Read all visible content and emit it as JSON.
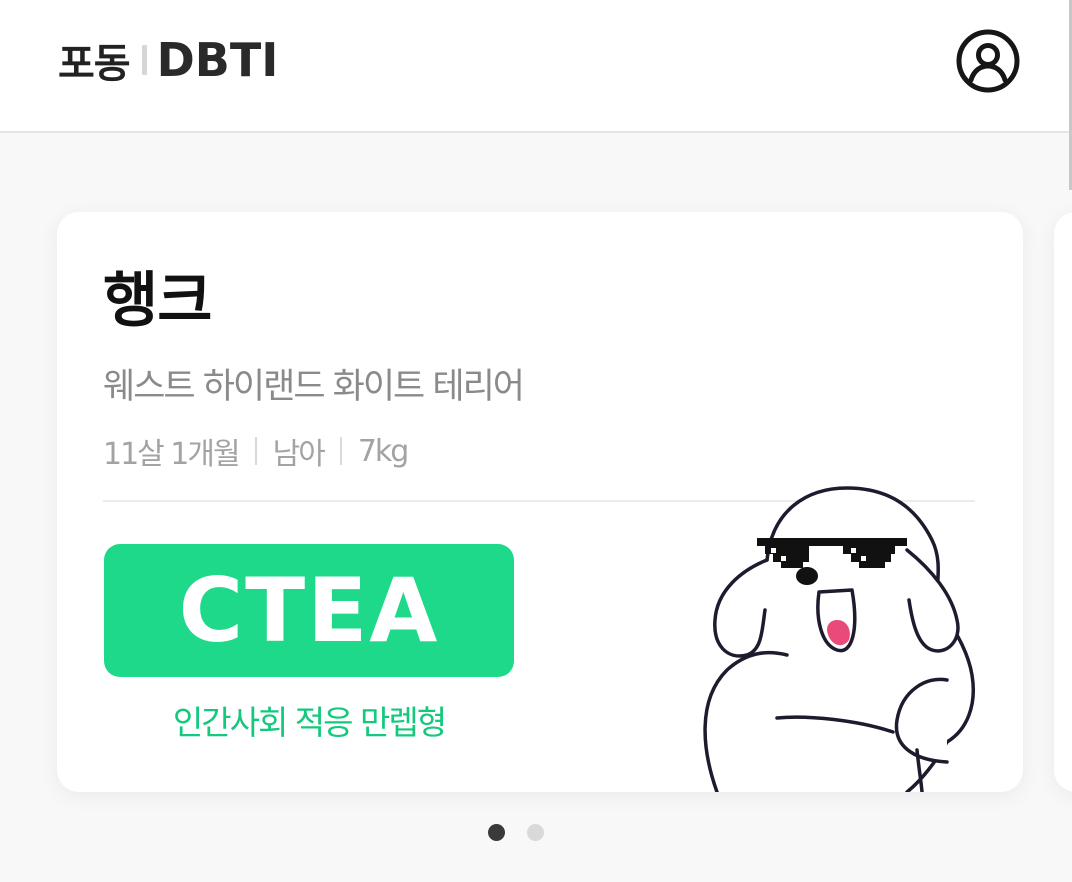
{
  "header": {
    "logo_ko": "포동",
    "logo_en": "DBTI",
    "profile_icon": "user-circle-icon"
  },
  "card": {
    "name": "행크",
    "breed": "웨스트 하이랜드 화이트 테리어",
    "meta": {
      "age": "11살 1개월",
      "gender": "남아",
      "weight": "7kg"
    },
    "type_code": "CTEA",
    "type_description": "인간사회 적응 만렙형",
    "illustration": "dog-with-sunglasses-illustration"
  },
  "pagination": {
    "total": 2,
    "current": 1
  },
  "colors": {
    "accent": "#1ed98a",
    "accent_text": "#14c97d",
    "title": "#111111",
    "subtitle": "#8a8a8a",
    "meta": "#a3a3a3",
    "dot_active": "#3a3a3a",
    "dot_inactive": "#d9d9d9"
  }
}
